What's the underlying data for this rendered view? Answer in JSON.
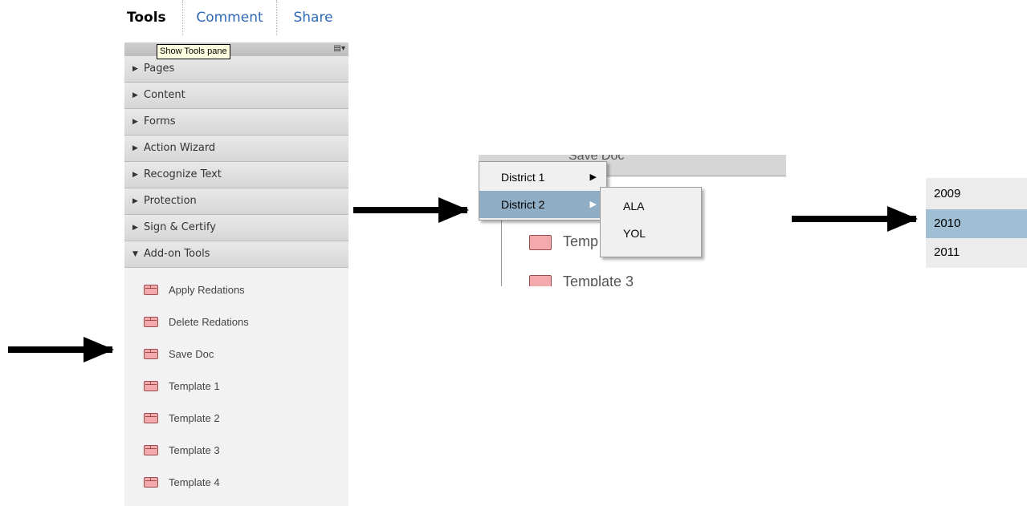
{
  "tabs": {
    "tools": "Tools",
    "comment": "Comment",
    "share": "Share"
  },
  "tooltip": "Show Tools pane",
  "panels": [
    {
      "label": "Pages",
      "state": "collapsed"
    },
    {
      "label": "Content",
      "state": "collapsed"
    },
    {
      "label": "Forms",
      "state": "collapsed"
    },
    {
      "label": "Action Wizard",
      "state": "collapsed"
    },
    {
      "label": "Recognize Text",
      "state": "collapsed"
    },
    {
      "label": "Protection",
      "state": "collapsed"
    },
    {
      "label": "Sign & Certify",
      "state": "collapsed"
    },
    {
      "label": "Add-on Tools",
      "state": "expanded"
    }
  ],
  "addon_tools": [
    "Apply Redations",
    "Delete Redations",
    "Save Doc",
    "Template 1",
    "Template 2",
    "Template 3",
    "Template 4"
  ],
  "district_menu": {
    "items": [
      {
        "label": "District 1",
        "has_submenu": true,
        "selected": false
      },
      {
        "label": "District 2",
        "has_submenu": true,
        "selected": true
      }
    ],
    "submenu": [
      "ALA",
      "YOL"
    ],
    "background_fragments": [
      "Save Doc",
      "Temp",
      "Template 3"
    ]
  },
  "year_menu": {
    "items": [
      "2009",
      "2010",
      "2011"
    ],
    "selected": "2010"
  },
  "colors": {
    "tab_link": "#2e69b6",
    "menu_selected": "#8faec6",
    "year_selected": "#a0bfd4",
    "tool_icon_fill": "#f4a9ac"
  },
  "icons": {
    "tool_item": "box-icon",
    "options": "options-menu-icon",
    "collapsed": "triangle-right-icon",
    "expanded": "triangle-down-icon",
    "submenu": "submenu-arrow-icon",
    "pointer": "arrow-right-icon"
  }
}
